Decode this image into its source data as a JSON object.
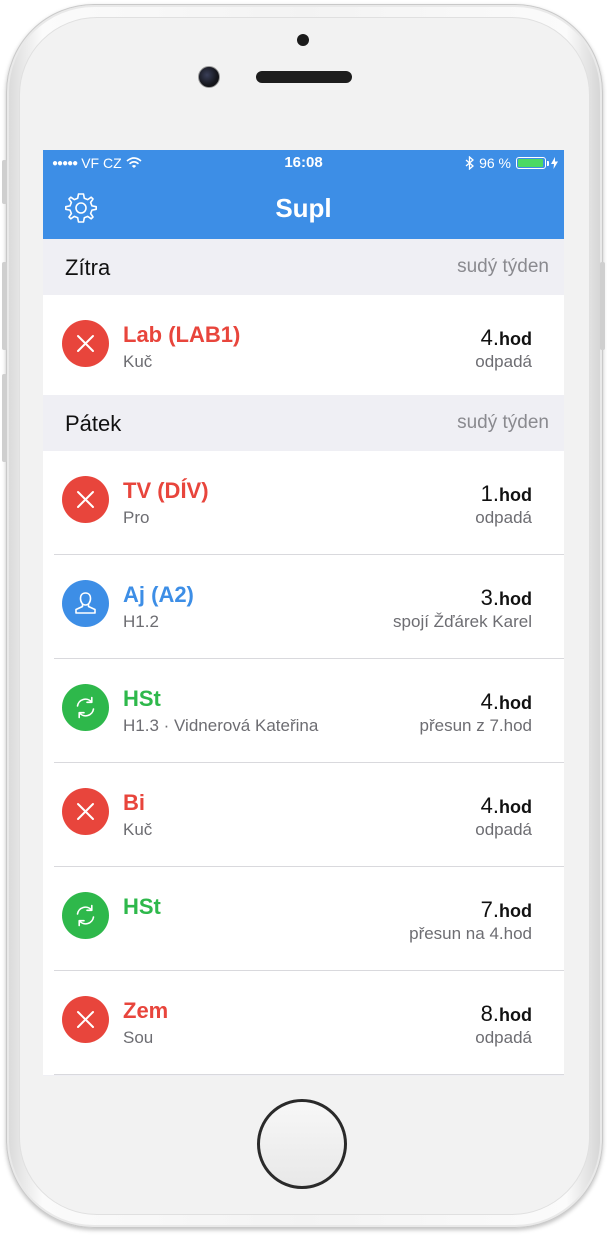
{
  "status_bar": {
    "carrier": "VF CZ",
    "time": "16:08",
    "battery": "96 %",
    "battery_level": 0.96,
    "icons": [
      "signal-dots-icon",
      "wifi-icon",
      "bluetooth-icon",
      "battery-icon",
      "charging-icon"
    ]
  },
  "navbar": {
    "title": "Supl",
    "settings_icon": "gear-icon"
  },
  "colors": {
    "accent": "#3d8ee6",
    "cancelled": "#e8453c",
    "moved": "#2eb84b",
    "background": "#efeff4"
  },
  "sections": [
    {
      "title": "Zítra",
      "week": "sudý týden",
      "items": [
        {
          "status": "cancelled",
          "icon": "close-icon",
          "subject": "Lab (LAB1)",
          "detail": "Kuč",
          "lesson": "4.",
          "lesson_unit": "hod",
          "action": "odpadá"
        }
      ]
    },
    {
      "title": "Pátek",
      "week": "sudý týden",
      "items": [
        {
          "status": "cancelled",
          "icon": "close-icon",
          "subject": "TV (DÍV)",
          "detail": "Pro",
          "lesson": "1.",
          "lesson_unit": "hod",
          "action": "odpadá"
        },
        {
          "status": "merged",
          "icon": "person-icon",
          "subject": "Aj (A2)",
          "detail": "H1.2",
          "lesson": "3.",
          "lesson_unit": "hod",
          "action": "spojí Žďárek Karel"
        },
        {
          "status": "moved",
          "icon": "refresh-icon",
          "subject": "HSt",
          "detail": "H1.3 · Vidnerová Kateřina",
          "lesson": "4.",
          "lesson_unit": "hod",
          "action": "přesun z 7.hod"
        },
        {
          "status": "cancelled",
          "icon": "close-icon",
          "subject": "Bi",
          "detail": "Kuč",
          "lesson": "4.",
          "lesson_unit": "hod",
          "action": "odpadá"
        },
        {
          "status": "moved",
          "icon": "refresh-icon",
          "subject": "HSt",
          "detail": "",
          "lesson": "7.",
          "lesson_unit": "hod",
          "action": "přesun na 4.hod"
        },
        {
          "status": "cancelled",
          "icon": "close-icon",
          "subject": "Zem",
          "detail": "Sou",
          "lesson": "8.",
          "lesson_unit": "hod",
          "action": "odpadá"
        }
      ]
    }
  ]
}
